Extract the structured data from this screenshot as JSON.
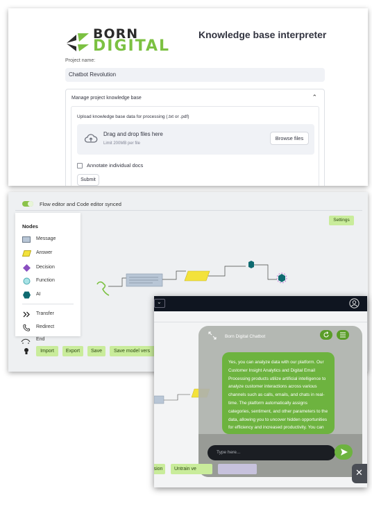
{
  "kb_app": {
    "logo": {
      "word1": "BORN",
      "word2": "DIGITAL",
      "brand_dark": "#2b2b2b",
      "brand_green": "#7cc142"
    },
    "title": "Knowledge base interpreter",
    "project_label": "Project name:",
    "project_value": "Chatbot Revolution",
    "expander_title": "Manage project knowledge base",
    "upload_label": "Upload knowledge base data for processing (.txt or .pdf)",
    "dropzone_title": "Drag and drop files here",
    "dropzone_limit": "Limit 200MB per file",
    "browse_label": "Browse files",
    "annotate_label": "Annotate individual docs",
    "submit_label": "Submit"
  },
  "flow_editor": {
    "sync_label": "Flow editor and Code editor synced",
    "settings_label": "Settings",
    "nodes_title": "Nodes",
    "nodes": [
      {
        "label": "Message",
        "icon": "message-node-icon"
      },
      {
        "label": "Answer",
        "icon": "answer-node-icon"
      },
      {
        "label": "Decision",
        "icon": "decision-node-icon"
      },
      {
        "label": "Function",
        "icon": "function-node-icon"
      },
      {
        "label": "AI",
        "icon": "ai-node-icon"
      },
      {
        "label": "Transfer",
        "icon": "transfer-node-icon"
      },
      {
        "label": "Redirect",
        "icon": "redirect-node-icon"
      }
    ],
    "end_label": "End",
    "buttons": [
      "Import",
      "Export",
      "Save",
      "Save model vers"
    ],
    "accent": "#c9ec9b"
  },
  "chatbot": {
    "title": "Born Digital Chatbot",
    "message": "Yes, you can analyze data with our platform. Our Customer Insight Analytics and Digital Email Processing products utilize artificial intelligence to analyze customer interactions across various channels such as calls, emails, and chats in real-time. The platform automatically assigns categories, sentiment, and other parameters to the data, allowing you to uncover hidden opportunities for efficiency and increased productivity. You can",
    "input_placeholder": "Type here...",
    "bottom_buttons": [
      "sion",
      "Untrain ve"
    ],
    "accent": "#6db33f"
  }
}
